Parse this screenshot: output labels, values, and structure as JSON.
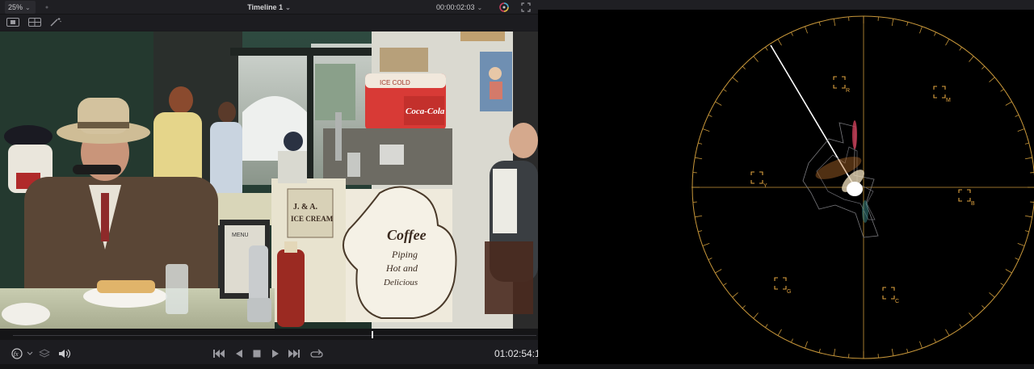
{
  "viewer": {
    "zoom": "25%",
    "timeline_name": "Timeline 1",
    "source_timecode": "00:00:02:03",
    "record_timecode": "01:02:54:1",
    "playhead_progress": 0.686
  },
  "scene_signs": {
    "soda_brand": "Coca-Cola",
    "soda_header": "ICE COLD",
    "counter_sign_line1": "J. & A.",
    "counter_sign_line2": "ICE CREAM",
    "pot_line1": "Coffee",
    "pot_line2": "Piping",
    "pot_line3": "Hot and",
    "pot_line4": "Delicious",
    "menu": "MENU"
  },
  "vectorscope": {
    "targets": [
      {
        "label": "R"
      },
      {
        "label": "M"
      },
      {
        "label": "B"
      },
      {
        "label": "C"
      },
      {
        "label": "G"
      },
      {
        "label": "Y"
      }
    ],
    "graticule_color": "#c8973a",
    "target_color": "#e0a340"
  },
  "colors": {
    "accent": "#c8973a",
    "panel": "#1c1c20"
  }
}
